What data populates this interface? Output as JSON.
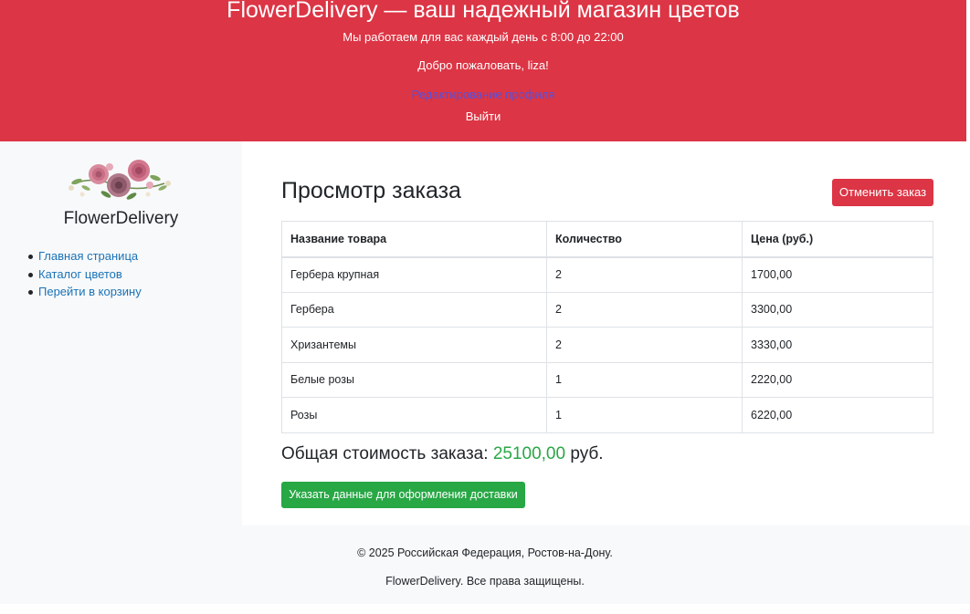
{
  "header": {
    "title": "FlowerDelivery — ваш надежный магазин цветов",
    "hours": "Мы работаем для вас каждый день с 8:00 до 22:00",
    "welcome": "Добро пожаловать, liza!",
    "edit_profile": "Редактирование профиля",
    "logout": "Выйти",
    "background_color": "#dc3545"
  },
  "sidebar": {
    "logo_icon": "flower-bouquet-icon",
    "brand": "FlowerDelivery",
    "items": [
      {
        "label": "Главная страница"
      },
      {
        "label": "Каталог цветов"
      },
      {
        "label": "Перейти в корзину"
      }
    ]
  },
  "main": {
    "title": "Просмотр заказа",
    "cancel_button": "Отменить заказ",
    "table": {
      "headers": [
        "Название товара",
        "Количество",
        "Цена (руб.)"
      ],
      "rows": [
        [
          "Гербера крупная",
          "2",
          "1700,00"
        ],
        [
          "Гербера",
          "2",
          "3300,00"
        ],
        [
          "Хризантемы",
          "2",
          "3330,00"
        ],
        [
          "Белые розы",
          "1",
          "2220,00"
        ],
        [
          "Розы",
          "1",
          "6220,00"
        ]
      ]
    },
    "total_label": "Общая стоимость заказа:",
    "total_value": "25100,00",
    "total_currency": "руб.",
    "delivery_button": "Указать данные для оформления доставки",
    "accent_success": "#28a745",
    "accent_danger": "#dc3545"
  },
  "footer": {
    "line1": "© 2025 Российская Федерация, Ростов-на-Дону.",
    "line2": "FlowerDelivery. Все права защищены."
  }
}
